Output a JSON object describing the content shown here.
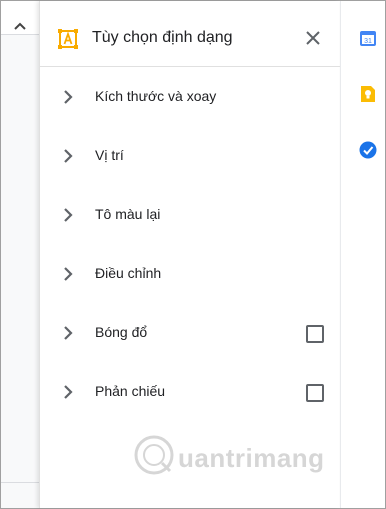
{
  "panel": {
    "title": "Tùy chọn định dạng",
    "close_icon": "close-icon",
    "sections": [
      {
        "label": "Kích thước và xoay",
        "has_checkbox": false,
        "checked": false
      },
      {
        "label": "Vị trí",
        "has_checkbox": false,
        "checked": false
      },
      {
        "label": "Tô màu lại",
        "has_checkbox": false,
        "checked": false
      },
      {
        "label": "Điều chỉnh",
        "has_checkbox": false,
        "checked": false
      },
      {
        "label": "Bóng đổ",
        "has_checkbox": true,
        "checked": false
      },
      {
        "label": "Phản chiếu",
        "has_checkbox": true,
        "checked": false
      }
    ]
  },
  "side_rail": {
    "icons": [
      "calendar-icon",
      "keep-icon",
      "tasks-icon"
    ],
    "colors": {
      "calendar": "#4285f4",
      "keep": "#fbbc04",
      "tasks": "#1a73e8"
    }
  },
  "watermark": {
    "text": "uantrimang"
  },
  "colors": {
    "accent": "#f9ab00",
    "text": "#202124",
    "icon_gray": "#5f6368"
  }
}
